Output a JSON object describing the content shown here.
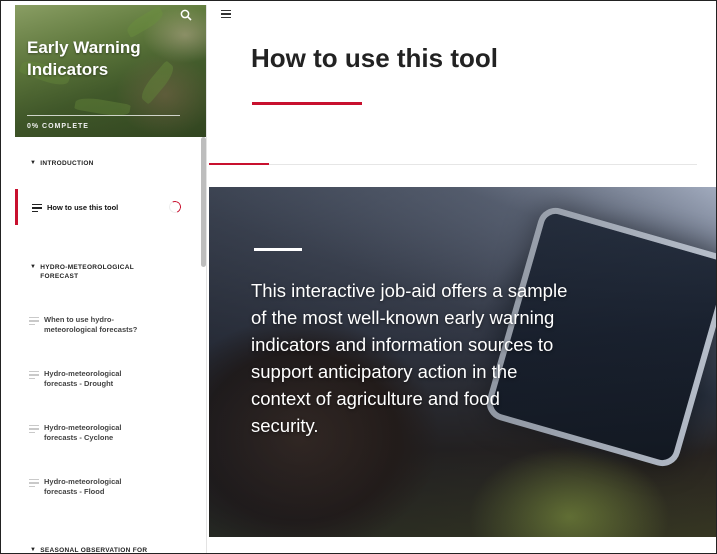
{
  "sidebar": {
    "course_title": "Early Warning Indicators",
    "progress_text": "0% COMPLETE",
    "sections": [
      {
        "heading": "INTRODUCTION",
        "items": [
          {
            "label": "How to use this tool",
            "active": true
          }
        ]
      },
      {
        "heading": "HYDRO-METEOROLOGICAL FORECAST",
        "items": [
          {
            "label": "When to use hydro-meteorological forecasts?",
            "active": false
          },
          {
            "label": "Hydro-meteorological forecasts - Drought",
            "active": false
          },
          {
            "label": "Hydro-meteorological forecasts - Cyclone",
            "active": false
          },
          {
            "label": "Hydro-meteorological forecasts - Flood",
            "active": false
          }
        ]
      },
      {
        "heading": "SEASONAL OBSERVATION FOR",
        "items": []
      }
    ]
  },
  "main": {
    "page_title": "How to use this tool",
    "banner_text": "This interactive job-aid offers a sample of the most well-known early warning indicators and information sources to support anticipatory action in the context of agriculture and food security."
  },
  "colors": {
    "accent": "#c8102e"
  },
  "icons": {
    "search": "search-icon",
    "menu": "menu-icon",
    "lesson": "lesson-icon"
  }
}
